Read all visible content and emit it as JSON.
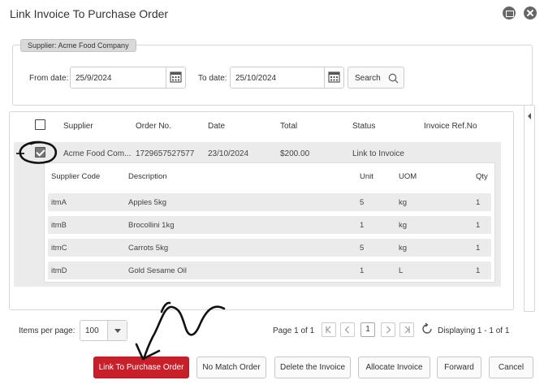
{
  "window": {
    "title": "Link Invoice To Purchase Order"
  },
  "filters": {
    "supplier_tag": "Supplier: Acme Food Company",
    "from_label": "From date:",
    "from_value": "25/9/2024",
    "to_label": "To date:",
    "to_value": "25/10/2024",
    "search_label": "Search"
  },
  "grid": {
    "columns": [
      "Supplier",
      "Order No.",
      "Date",
      "Total",
      "Status",
      "Invoice Ref.No"
    ],
    "row": {
      "supplier": "Acme Food Com...",
      "order_no": "1729657527577",
      "date": "23/10/2024",
      "total": "$200.00",
      "status": "Link to Invoice",
      "invoice_ref": "",
      "checked": true
    },
    "detail_columns": [
      "Supplier Code",
      "Description",
      "Unit",
      "UOM",
      "Qty"
    ],
    "detail_rows": [
      {
        "code": "itmA",
        "description": "Apples 5kg",
        "unit": "5",
        "uom": "kg",
        "qty": "1"
      },
      {
        "code": "itmB",
        "description": "Brocollini 1kg",
        "unit": "1",
        "uom": "kg",
        "qty": "1"
      },
      {
        "code": "itmC",
        "description": "Carrots 5kg",
        "unit": "5",
        "uom": "kg",
        "qty": "1"
      },
      {
        "code": "itmD",
        "description": "Gold Sesame Oil",
        "unit": "1",
        "uom": "L",
        "qty": "1"
      }
    ]
  },
  "pager": {
    "items_per_page_label": "Items per page:",
    "items_per_page_value": "100",
    "page_info": "Page 1 of 1",
    "current_page": "1",
    "displaying": "Displaying 1 - 1 of 1"
  },
  "actions": {
    "link": "Link To Purchase Order",
    "no_match": "No Match Order",
    "delete": "Delete the Invoice",
    "allocate": "Allocate Invoice",
    "forward": "Forward",
    "cancel": "Cancel"
  },
  "colors": {
    "primary": "#c8202b"
  }
}
